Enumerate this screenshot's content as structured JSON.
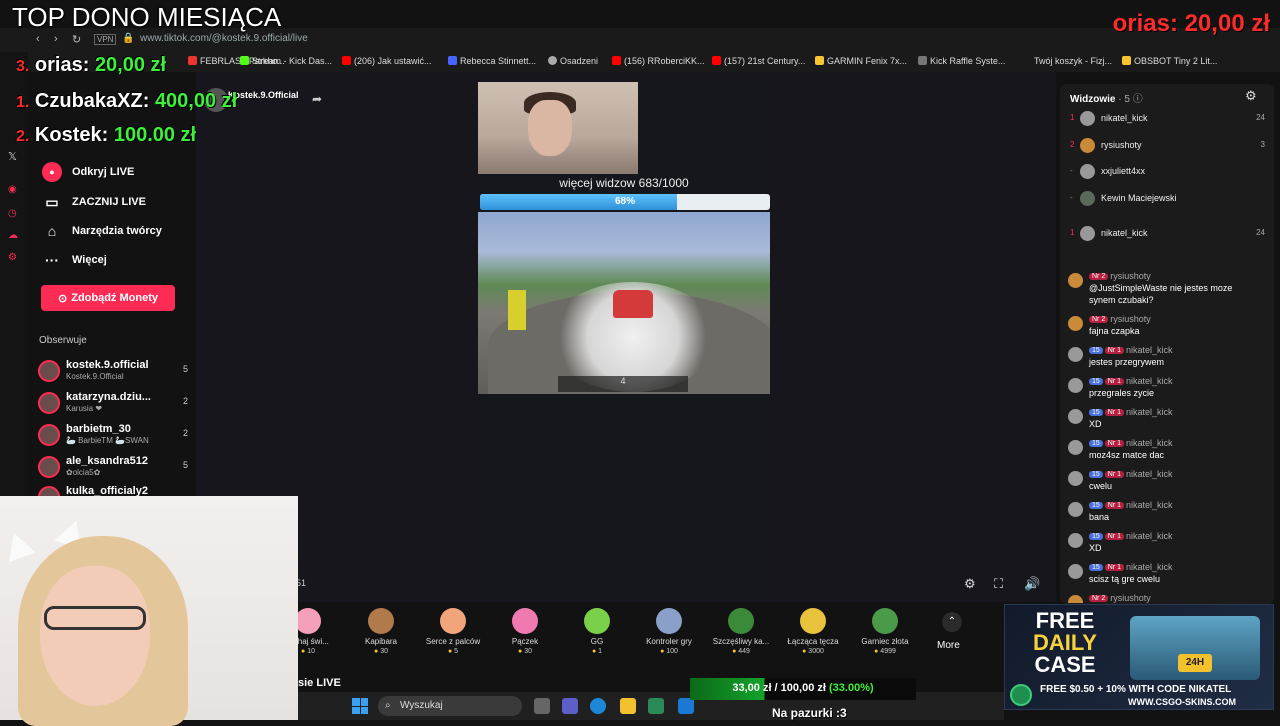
{
  "overlay": {
    "title": "TOP DONO MIESIĄCA",
    "donors": [
      {
        "rank": "3.",
        "name": "orias:",
        "amount": "20,00 zł"
      },
      {
        "rank": "1.",
        "name": "CzubakaXZ:",
        "amount": "400,00 zł"
      },
      {
        "rank": "2.",
        "name": "Kostek:",
        "amount": "100.00 zł"
      }
    ],
    "top_right": "orias: 20,00 zł"
  },
  "browser": {
    "url": "www.tiktok.com/@kostek.9.official/live",
    "vpn": "VPN",
    "bookmarks": [
      "FEBRLAST Parkho...",
      "Stream - Kick Das...",
      "(206) Jak ustawić...",
      "Rebecca Stinnett...",
      "Osadzeni",
      "(156) RRoberciKK...",
      "(157) 21st Century...",
      "GARMIN Fenix 7x...",
      "Kick Raffle Syste...",
      "Twój koszyk - Fizj...",
      "OBSBOT Tiny 2 Lit..."
    ]
  },
  "sidebar": {
    "items": [
      {
        "label": "Odkryj LIVE",
        "icon": "live-icon"
      },
      {
        "label": "ZACZNIJ LIVE",
        "icon": "camera-icon"
      },
      {
        "label": "Narzędzia twórcy",
        "icon": "home-icon"
      },
      {
        "label": "Więcej",
        "icon": "more-icon"
      }
    ],
    "coins_label": "Zdobądź Monety",
    "following_label": "Obserwuje",
    "following": [
      {
        "name": "kostek.9.official",
        "sub": "Kostek.9.Official",
        "count": "5"
      },
      {
        "name": "katarzyna.dziu...",
        "sub": "Karusia ❤",
        "count": "2"
      },
      {
        "name": "barbietm_30",
        "sub": "🦢 BarbieTM 🦢SWAN",
        "count": "2"
      },
      {
        "name": "ale_ksandra512",
        "sub": "✿olcia5✿",
        "count": "5"
      },
      {
        "name": "kulka_officialy2",
        "sub": "",
        "count": ""
      }
    ]
  },
  "stream": {
    "streamer": "Kostek.9.Official",
    "viewers_goal": "więcej widzow 683/1000",
    "progress_label": "68%",
    "progress": 0.68,
    "hud_value": "4",
    "small_label": "51"
  },
  "gifts": [
    {
      "name": "...chaj świ...",
      "price": "10",
      "color": "#f4a0b8"
    },
    {
      "name": "Kapibara",
      "price": "30",
      "color": "#b07a4a"
    },
    {
      "name": "Serce z palców",
      "price": "5",
      "color": "#f2a57a"
    },
    {
      "name": "Pączek",
      "price": "30",
      "color": "#f07ab0"
    },
    {
      "name": "GG",
      "price": "1",
      "color": "#7bd04a"
    },
    {
      "name": "Kontroler gry",
      "price": "100",
      "color": "#8aa0c8"
    },
    {
      "name": "Szczęśliwy ka...",
      "price": "449",
      "color": "#3a8a3a"
    },
    {
      "name": "Łącząca tęcza",
      "price": "3000",
      "color": "#e8c23a"
    },
    {
      "name": "Garniec złota",
      "price": "4999",
      "color": "#4a9a4a"
    }
  ],
  "more_label": "More",
  "viewers_panel": {
    "title": "Widzowie",
    "count": "· 5",
    "list": [
      {
        "rank": "1",
        "name": "nikatel_kick",
        "score": "24"
      },
      {
        "rank": "2",
        "name": "rysiushoty",
        "score": "3"
      },
      {
        "rank": "-",
        "name": "xxjuliett4xx",
        "score": ""
      },
      {
        "rank": "-",
        "name": "Kewin Maciejewski",
        "score": ""
      },
      {
        "rank": "1",
        "name": "nikatel_kick",
        "score": "24"
      }
    ]
  },
  "chat": [
    {
      "user": "rysiushoty",
      "badges": [
        "Nr 2"
      ],
      "msg": "@JustSimpleWaste nie jestes moze",
      "msg2": "synem czubaki?"
    },
    {
      "user": "rysiushoty",
      "badges": [
        "Nr 2"
      ],
      "msg": "fajna czapka",
      "msg2": ""
    },
    {
      "user": "nikatel_kick",
      "badges": [
        "15",
        "Nr 1"
      ],
      "msg": "jestes przegrywem",
      "msg2": ""
    },
    {
      "user": "nikatel_kick",
      "badges": [
        "15",
        "Nr 1"
      ],
      "msg": "przegrales zycie",
      "msg2": ""
    },
    {
      "user": "nikatel_kick",
      "badges": [
        "15",
        "Nr 1"
      ],
      "msg": "XD",
      "msg2": ""
    },
    {
      "user": "nikatel_kick",
      "badges": [
        "15",
        "Nr 1"
      ],
      "msg": "moz4sz matce dac",
      "msg2": ""
    },
    {
      "user": "nikatel_kick",
      "badges": [
        "15",
        "Nr 1"
      ],
      "msg": "cwelu",
      "msg2": ""
    },
    {
      "user": "nikatel_kick",
      "badges": [
        "15",
        "Nr 1"
      ],
      "msg": "bana",
      "msg2": ""
    },
    {
      "user": "nikatel_kick",
      "badges": [
        "15",
        "Nr 1"
      ],
      "msg": "XD",
      "msg2": ""
    },
    {
      "user": "nikatel_kick",
      "badges": [
        "15",
        "Nr 1"
      ],
      "msg": "scisz tą gre cwelu",
      "msg2": ""
    },
    {
      "user": "rysiushoty",
      "badges": [
        "Nr 2"
      ],
      "msg": "",
      "msg2": ""
    }
  ],
  "ad": {
    "line1": "FREE",
    "line2": "DAILY",
    "line3": "CASE",
    "badge": "24H",
    "code": "FREE $0.50 + 10% WITH CODE NIKATEL",
    "url": "WWW.CSGO-SKINS.COM"
  },
  "donation_goal": {
    "text": "33,00 zł / 100,00 zł",
    "pct": "(33.00%)",
    "progress": 0.33,
    "title": "Na pazurki :3"
  },
  "taskbar": {
    "search": "Wyszukaj",
    "left_label": "sie LIVE"
  }
}
